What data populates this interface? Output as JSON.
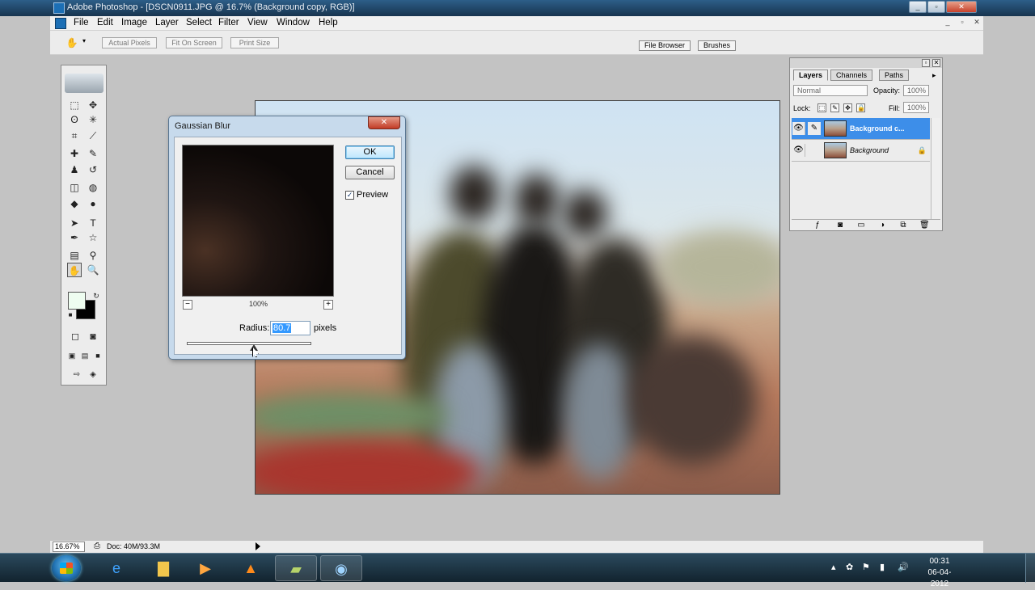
{
  "window": {
    "title": "Adobe Photoshop - [DSCN0911.JPG @ 16.7% (Background copy, RGB)]",
    "controls": [
      "_",
      "▫",
      "✕"
    ]
  },
  "menubar": {
    "items": [
      "File",
      "Edit",
      "Image",
      "Layer",
      "Select",
      "Filter",
      "View",
      "Window",
      "Help"
    ],
    "doc_controls": [
      "_",
      "▫",
      "✕"
    ]
  },
  "options": {
    "buttons": [
      "Actual Pixels",
      "Fit On Screen",
      "Print Size"
    ],
    "palette_well": [
      "File Browser",
      "Brushes"
    ]
  },
  "toolbox": {
    "tools": [
      {
        "name": "marquee-tool-icon",
        "glyph": "⬚"
      },
      {
        "name": "move-tool-icon",
        "glyph": "✥"
      },
      {
        "name": "lasso-tool-icon",
        "glyph": "ʘ"
      },
      {
        "name": "magic-wand-tool-icon",
        "glyph": "✳"
      },
      {
        "name": "crop-tool-icon",
        "glyph": "⌗"
      },
      {
        "name": "slice-tool-icon",
        "glyph": "⟋"
      },
      {
        "name": "healing-brush-tool-icon",
        "glyph": "✚"
      },
      {
        "name": "brush-tool-icon",
        "glyph": "✎"
      },
      {
        "name": "clone-stamp-tool-icon",
        "glyph": "♟"
      },
      {
        "name": "history-brush-tool-icon",
        "glyph": "↺"
      },
      {
        "name": "eraser-tool-icon",
        "glyph": "◫"
      },
      {
        "name": "paint-bucket-tool-icon",
        "glyph": "◍"
      },
      {
        "name": "blur-tool-icon",
        "glyph": "◆"
      },
      {
        "name": "dodge-tool-icon",
        "glyph": "●"
      },
      {
        "name": "path-selection-tool-icon",
        "glyph": "➤"
      },
      {
        "name": "type-tool-icon",
        "glyph": "T"
      },
      {
        "name": "pen-tool-icon",
        "glyph": "✒"
      },
      {
        "name": "shape-tool-icon",
        "glyph": "☆"
      },
      {
        "name": "notes-tool-icon",
        "glyph": "▤"
      },
      {
        "name": "eyedropper-tool-icon",
        "glyph": "⚲"
      },
      {
        "name": "hand-tool-icon",
        "glyph": "✋"
      },
      {
        "name": "zoom-tool-icon",
        "glyph": "🔍"
      }
    ]
  },
  "dialog": {
    "title": "Gaussian Blur",
    "ok_label": "OK",
    "cancel_label": "Cancel",
    "preview_label": "Preview",
    "preview_checked": "✓",
    "zoom_level": "100%",
    "zoom_out": "−",
    "zoom_in": "+",
    "radius_label": "Radius:",
    "radius_value": "80.7",
    "radius_units": "pixels"
  },
  "layers_panel": {
    "tabs": [
      "Layers",
      "Channels",
      "Paths"
    ],
    "blend_mode": "Normal",
    "opacity_label": "Opacity:",
    "opacity_value": "100%",
    "lock_label": "Lock:",
    "fill_label": "Fill:",
    "fill_value": "100%",
    "layers": [
      {
        "name": "Background c...",
        "active": true
      },
      {
        "name": "Background",
        "active": false
      }
    ]
  },
  "status": {
    "zoom": "16.67%",
    "doc": "Doc: 40M/93.3M"
  },
  "taskbar": {
    "clock_time": "00:31",
    "clock_date": "06-04-2012"
  }
}
